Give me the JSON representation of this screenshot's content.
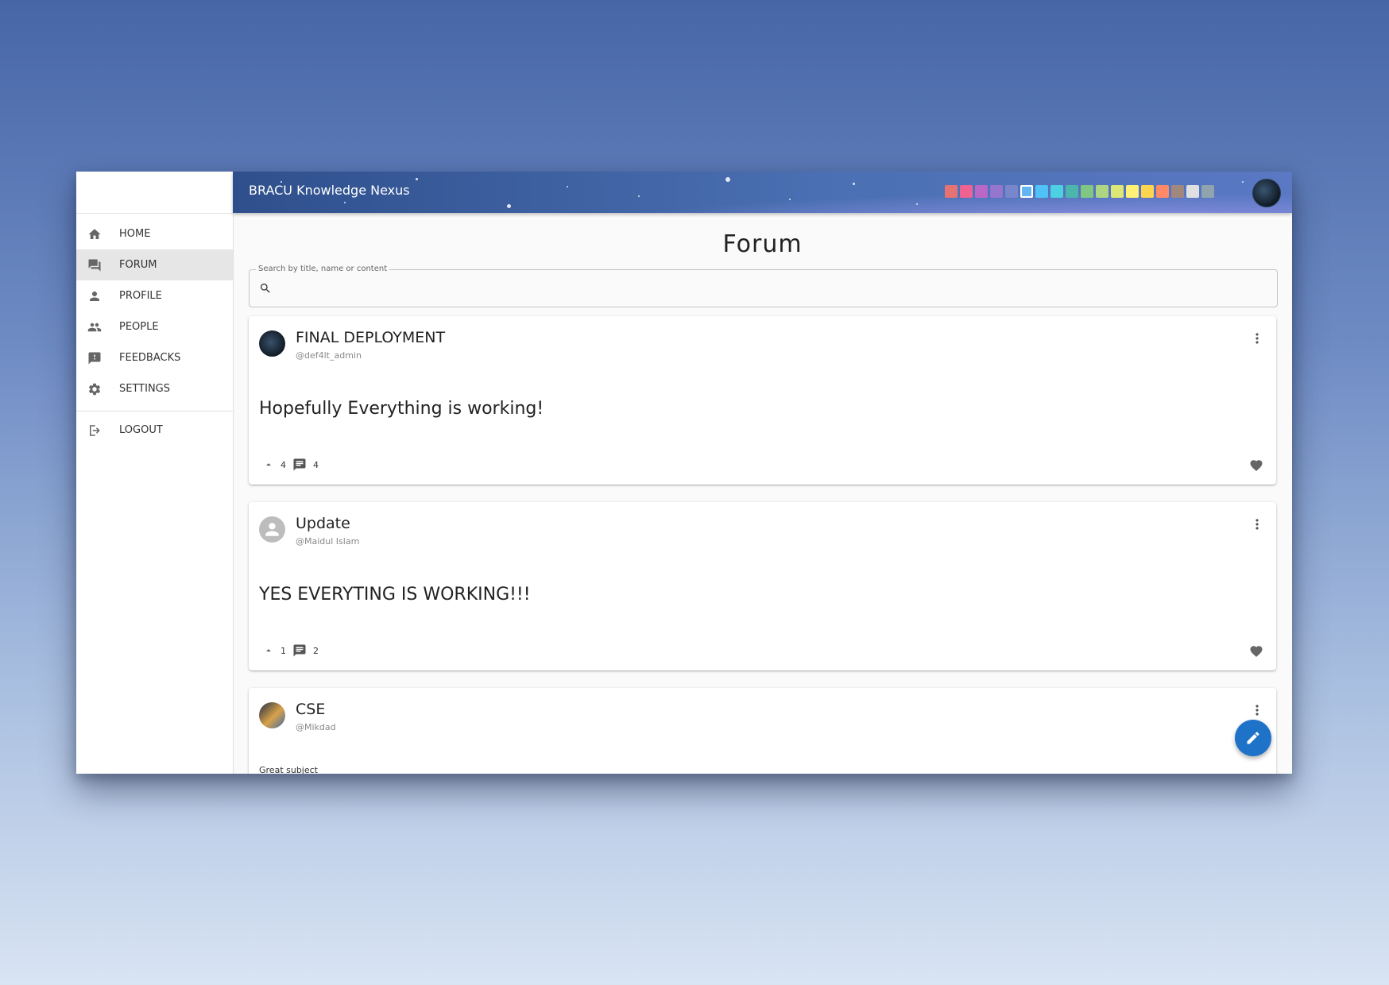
{
  "app": {
    "title": "BRACU Knowledge Nexus"
  },
  "sidebar": {
    "items": [
      {
        "label": "HOME",
        "icon": "home-icon"
      },
      {
        "label": "FORUM",
        "icon": "forum-icon",
        "active": true
      },
      {
        "label": "PROFILE",
        "icon": "person-icon"
      },
      {
        "label": "PEOPLE",
        "icon": "people-icon"
      },
      {
        "label": "FEEDBACKS",
        "icon": "feedback-icon"
      },
      {
        "label": "SETTINGS",
        "icon": "gear-icon"
      }
    ],
    "logout_label": "LOGOUT"
  },
  "theme_colors": [
    "#e57373",
    "#f06292",
    "#ba68c8",
    "#9575cd",
    "#7986cb",
    "#64b5f6",
    "#4fc3f7",
    "#4dd0e1",
    "#4db6ac",
    "#81c784",
    "#aed581",
    "#dce775",
    "#fff176",
    "#ffd54f",
    "#ff8a65",
    "#a1887f",
    "#e0e0e0",
    "#90a4ae"
  ],
  "selected_theme_index": 5,
  "page": {
    "title": "Forum"
  },
  "search": {
    "label": "Search by title, name or content",
    "value": ""
  },
  "posts": [
    {
      "title": "FINAL DEPLOYMENT",
      "author": "@def4lt_admin",
      "body": "Hopefully Everything is working!",
      "upvotes": "4",
      "comments": "4"
    },
    {
      "title": "Update",
      "author": "@Maidul Islam",
      "body": "YES EVERYTING IS WORKING!!!",
      "upvotes": "1",
      "comments": "2"
    },
    {
      "title": "CSE",
      "author": "@Mikdad",
      "body": "Great subject"
    }
  ],
  "colors": {
    "accent": "#1e73c9",
    "appbar": "#4a6fb2",
    "active_nav": "#e6e6e6"
  }
}
